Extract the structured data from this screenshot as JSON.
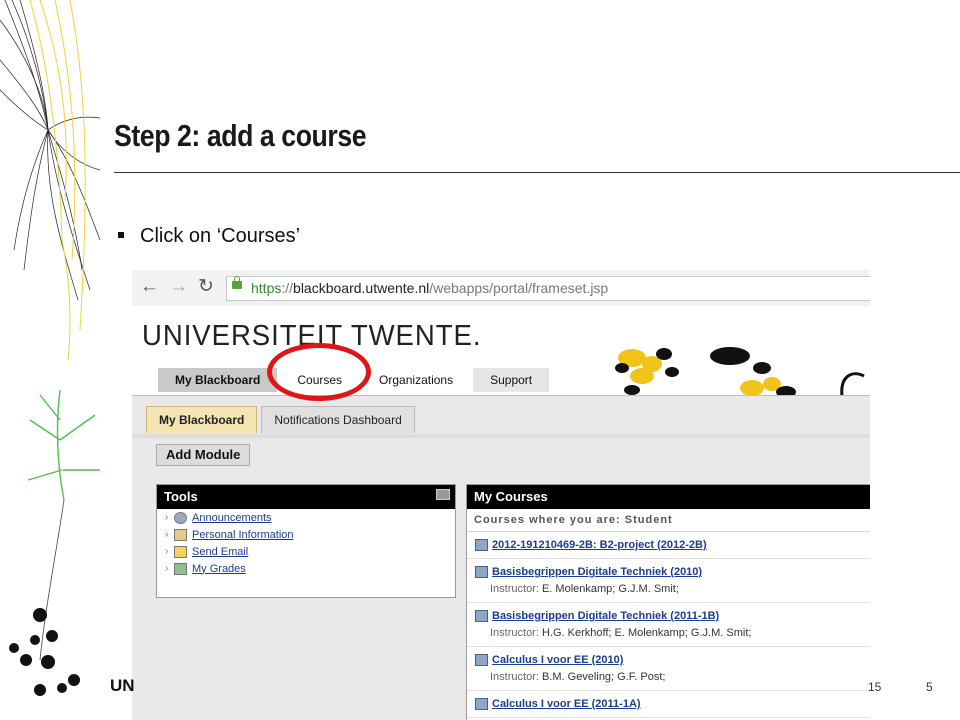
{
  "slide": {
    "title": "Step 2: add a course",
    "bullet": "Click on ‘Courses’",
    "footer_logo": "UN",
    "footer_date": "15",
    "page_number": "5"
  },
  "browser": {
    "url_scheme": "https",
    "url_sep": "://",
    "url_host": "blackboard.utwente.nl",
    "url_path": "/webapps/portal/frameset.jsp"
  },
  "blackboard": {
    "logo": "UNIVERSITEIT TWENTE.",
    "tabs": [
      {
        "label": "My Blackboard"
      },
      {
        "label": "Courses"
      },
      {
        "label": "Organizations"
      },
      {
        "label": "Support"
      }
    ],
    "subtabs": [
      {
        "label": "My Blackboard"
      },
      {
        "label": "Notifications Dashboard"
      }
    ],
    "add_module": "Add Module",
    "tools": {
      "title": "Tools",
      "items": [
        {
          "label": "Announcements",
          "icon": "megaphone-icon"
        },
        {
          "label": "Personal Information",
          "icon": "id-card-icon"
        },
        {
          "label": "Send Email",
          "icon": "envelope-icon"
        },
        {
          "label": "My Grades",
          "icon": "grades-icon"
        }
      ]
    },
    "my_courses": {
      "title": "My Courses",
      "role_line": "Courses where you are: Student",
      "instructor_label": "Instructor:",
      "courses": [
        {
          "name": "2012-191210469-2B: B2-project (2012-2B)",
          "instructors": ""
        },
        {
          "name": "Basisbegrippen Digitale Techniek (2010)",
          "instructors": "E. Molenkamp;  G.J.M. Smit;"
        },
        {
          "name": "Basisbegrippen Digitale Techniek (2011-1B)",
          "instructors": "H.G. Kerkhoff;  E. Molenkamp;  G.J.M. Smit;"
        },
        {
          "name": "Calculus I voor EE (2010)",
          "instructors": "B.M. Geveling;  G.F. Post;"
        },
        {
          "name": "Calculus I voor EE (2011-1A)",
          "instructors": ""
        }
      ]
    }
  }
}
